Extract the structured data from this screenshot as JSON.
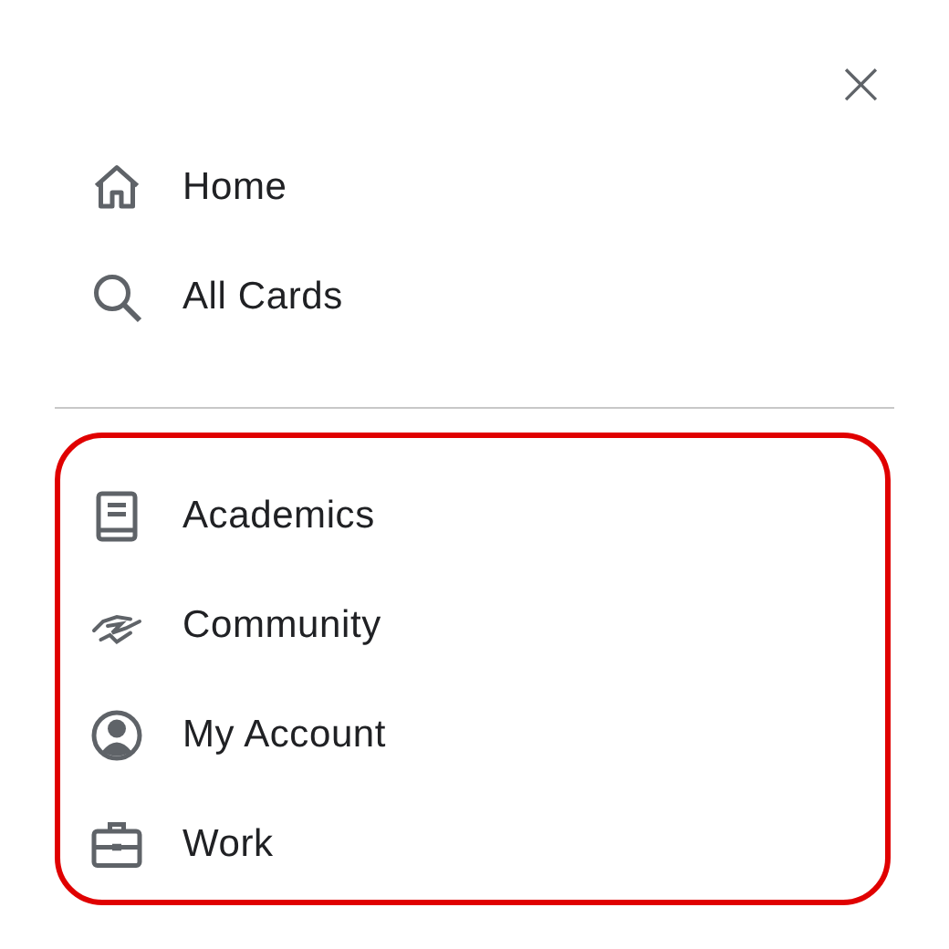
{
  "close_button": {
    "label": "×"
  },
  "main_items": [
    {
      "label": "Home"
    },
    {
      "label": "All Cards"
    }
  ],
  "category_group": {
    "highlighted": true,
    "items": [
      {
        "label": "Academics"
      },
      {
        "label": "Community"
      },
      {
        "label": "My Account"
      },
      {
        "label": "Work"
      }
    ]
  }
}
